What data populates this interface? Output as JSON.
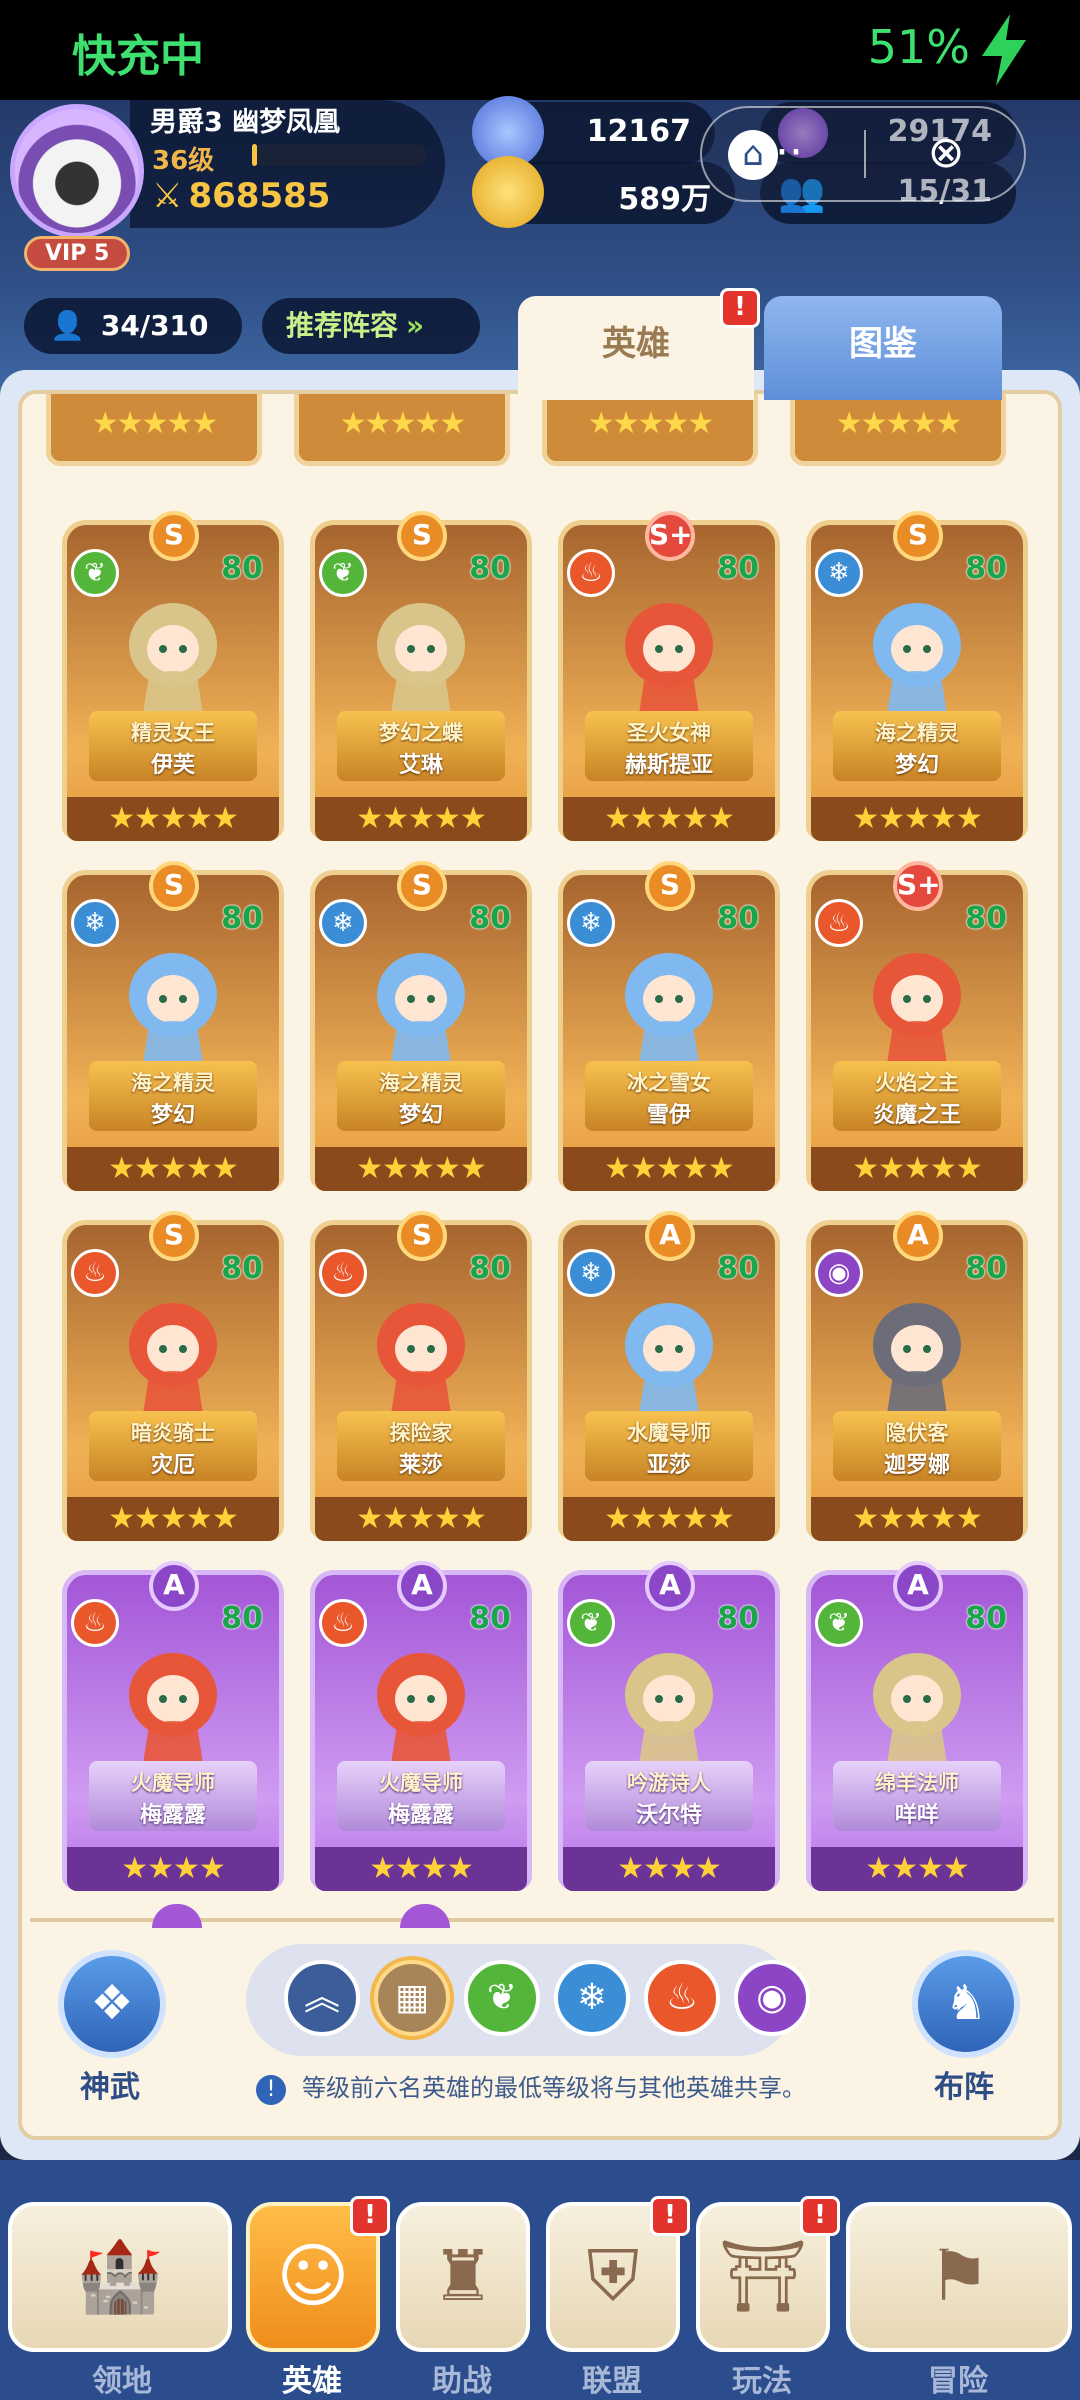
{
  "status": {
    "charging": "快充中",
    "battery": "51%"
  },
  "player": {
    "name": "男爵3 幽梦凤凰",
    "level": "36级",
    "xp_fraction": 0.03,
    "power": "868585",
    "vip": "VIP 5"
  },
  "resources": {
    "gems": "12167",
    "gold": "589万",
    "purple": "29174",
    "team": "15/31"
  },
  "capsule": {
    "more": "···",
    "close": "⊗"
  },
  "bar": {
    "hero_count": "34/310",
    "recommend": "推荐阵容"
  },
  "tabs": {
    "heroes": "英雄",
    "codex": "图鉴",
    "badge": "!"
  },
  "stars5": "★★★★★",
  "stars4": "★★★★",
  "cards": [
    {
      "rank": "S",
      "el": "nat",
      "lv": "80",
      "title": "精灵女王",
      "name": "伊芙"
    },
    {
      "rank": "S",
      "el": "nat",
      "lv": "80",
      "title": "梦幻之蝶",
      "name": "艾琳"
    },
    {
      "rank": "S+",
      "el": "fire",
      "lv": "80",
      "title": "圣火女神",
      "name": "赫斯提亚"
    },
    {
      "rank": "S",
      "el": "ice",
      "lv": "80",
      "title": "海之精灵",
      "name": "梦幻"
    },
    {
      "rank": "S",
      "el": "ice",
      "lv": "80",
      "title": "海之精灵",
      "name": "梦幻"
    },
    {
      "rank": "S",
      "el": "ice",
      "lv": "80",
      "title": "海之精灵",
      "name": "梦幻"
    },
    {
      "rank": "S",
      "el": "ice",
      "lv": "80",
      "title": "冰之雪女",
      "name": "雪伊"
    },
    {
      "rank": "S+",
      "el": "fire",
      "lv": "80",
      "title": "火焰之主",
      "name": "炎魔之王"
    },
    {
      "rank": "S",
      "el": "fire",
      "lv": "80",
      "title": "暗炎骑士",
      "name": "灾厄"
    },
    {
      "rank": "S",
      "el": "fire",
      "lv": "80",
      "title": "探险家",
      "name": "莱莎"
    },
    {
      "rank": "A",
      "el": "ice",
      "lv": "80",
      "title": "水魔导师",
      "name": "亚莎"
    },
    {
      "rank": "A",
      "el": "dark",
      "lv": "80",
      "title": "隐伏客",
      "name": "迦罗娜"
    },
    {
      "rank": "A",
      "el": "fire",
      "lv": "80",
      "title": "火魔导师",
      "name": "梅露露"
    },
    {
      "rank": "A",
      "el": "fire",
      "lv": "80",
      "title": "火魔导师",
      "name": "梅露露"
    },
    {
      "rank": "A",
      "el": "nat",
      "lv": "80",
      "title": "吟游诗人",
      "name": "沃尔特"
    },
    {
      "rank": "A",
      "el": "nat",
      "lv": "80",
      "title": "绵羊法师",
      "name": "咩咩"
    }
  ],
  "side": {
    "left": "神武",
    "right": "布阵"
  },
  "note": "等级前六名英雄的最低等级将与其他英雄共享。",
  "nav": [
    "领地",
    "英雄",
    "助战",
    "联盟",
    "玩法",
    "冒险"
  ]
}
